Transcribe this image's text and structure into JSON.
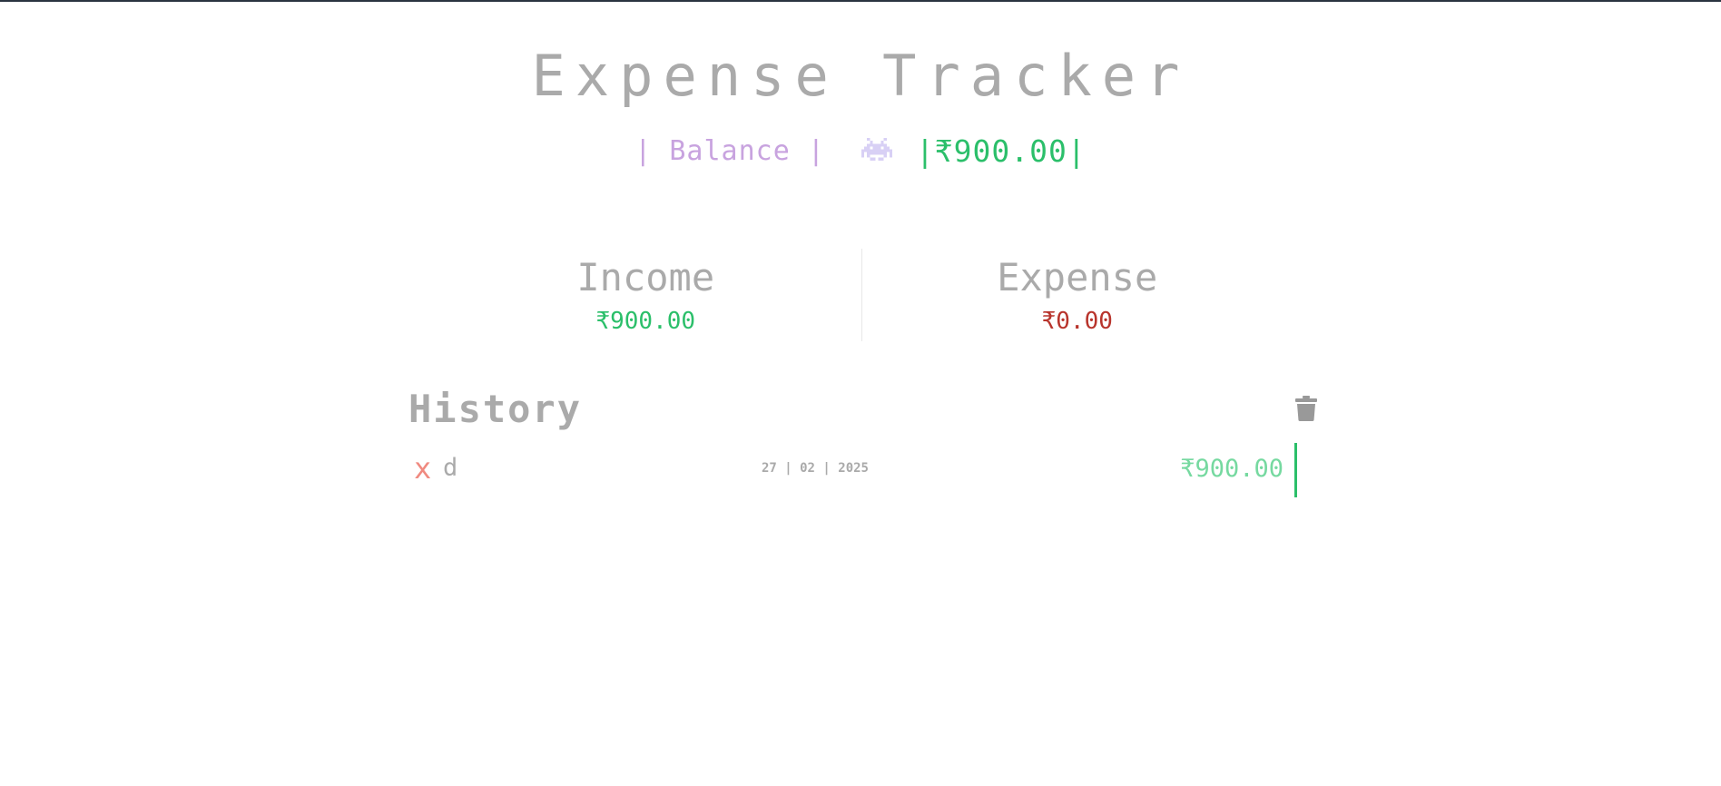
{
  "app": {
    "title": "Expense Tracker"
  },
  "balance": {
    "label": "| Balance |",
    "icon": "space-invader-icon",
    "value": "|₹900.00|"
  },
  "summary": {
    "income_label": "Income",
    "income_value": "₹900.00",
    "expense_label": "Expense",
    "expense_value": "₹0.00"
  },
  "history": {
    "title": "History",
    "clear_icon": "trash-icon",
    "items": [
      {
        "delete_label": "x",
        "text": "d",
        "date": "27 | 02 | 2025",
        "amount": "₹900.00"
      }
    ]
  },
  "colors": {
    "title_gray": "#aaaaaa",
    "balance_label": "#c8a3df",
    "income_green": "#2bbf6a",
    "expense_red": "#b8342c",
    "delete_red": "#f08a80",
    "icon_lavender": "#d8d0f5"
  }
}
